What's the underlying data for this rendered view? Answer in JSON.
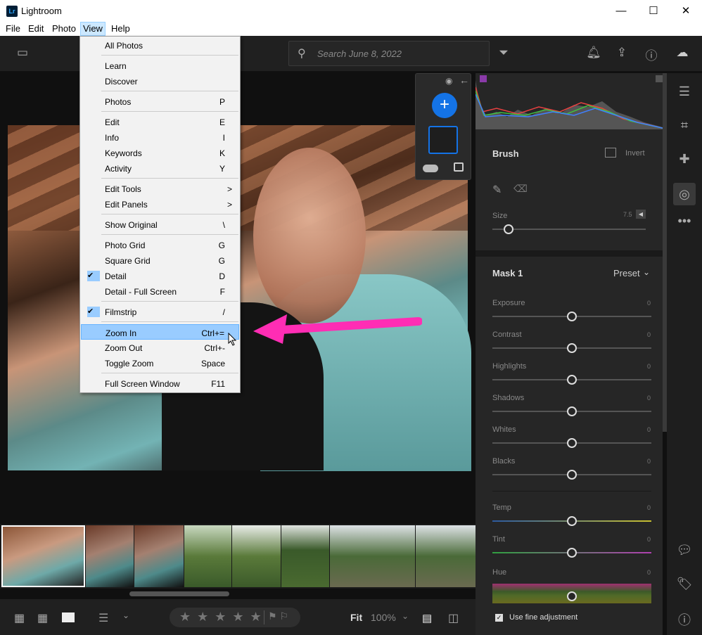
{
  "titlebar": {
    "app_icon": "Lr",
    "title": "Lightroom",
    "minimize": "—",
    "maximize": "☐",
    "close": "✕"
  },
  "menubar": {
    "items": [
      "File",
      "Edit",
      "Photo",
      "View",
      "Help"
    ]
  },
  "toolbar": {
    "search_placeholder": "Search June 8, 2022"
  },
  "view_menu": {
    "items": [
      {
        "label": "All Photos",
        "shortcut": ""
      },
      {
        "label": "Learn",
        "shortcut": ""
      },
      {
        "label": "Discover",
        "shortcut": ""
      },
      {
        "label": "Photos",
        "shortcut": "P"
      },
      {
        "label": "Edit",
        "shortcut": "E"
      },
      {
        "label": "Info",
        "shortcut": "I"
      },
      {
        "label": "Keywords",
        "shortcut": "K"
      },
      {
        "label": "Activity",
        "shortcut": "Y"
      },
      {
        "label": "Edit Tools",
        "shortcut": ">"
      },
      {
        "label": "Edit Panels",
        "shortcut": ">"
      },
      {
        "label": "Show Original",
        "shortcut": "\\"
      },
      {
        "label": "Photo Grid",
        "shortcut": "G"
      },
      {
        "label": "Square Grid",
        "shortcut": "G"
      },
      {
        "label": "Detail",
        "shortcut": "D",
        "checked": true
      },
      {
        "label": "Detail - Full Screen",
        "shortcut": "F"
      },
      {
        "label": "Filmstrip",
        "shortcut": "/",
        "checked": true
      },
      {
        "label": "Zoom In",
        "shortcut": "Ctrl+=",
        "highlighted": true
      },
      {
        "label": "Zoom Out",
        "shortcut": "Ctrl+-"
      },
      {
        "label": "Toggle Zoom",
        "shortcut": "Space"
      },
      {
        "label": "Full Screen Window",
        "shortcut": "F11"
      }
    ]
  },
  "brush": {
    "title": "Brush",
    "invert_label": "Invert",
    "size_label": "Size",
    "size_value": "7.5"
  },
  "mask": {
    "title": "Mask 1",
    "preset_label": "Preset",
    "sliders": [
      {
        "label": "Exposure",
        "value": "0"
      },
      {
        "label": "Contrast",
        "value": "0"
      },
      {
        "label": "Highlights",
        "value": "0"
      },
      {
        "label": "Shadows",
        "value": "0"
      },
      {
        "label": "Whites",
        "value": "0"
      },
      {
        "label": "Blacks",
        "value": "0"
      }
    ],
    "color_sliders": [
      {
        "label": "Temp",
        "value": "0"
      },
      {
        "label": "Tint",
        "value": "0"
      }
    ],
    "hue_label": "Hue",
    "hue_value": "0",
    "fine_adjust_label": "Use fine adjustment"
  },
  "bottombar": {
    "fit_label": "Fit",
    "zoom_label": "100%",
    "stars": "★ ★ ★ ★ ★",
    "flags": "⚑ ⚐"
  },
  "colors": {
    "accent": "#1473e6",
    "arrow": "#ff2db4",
    "menu_highlight": "#99ccff"
  }
}
